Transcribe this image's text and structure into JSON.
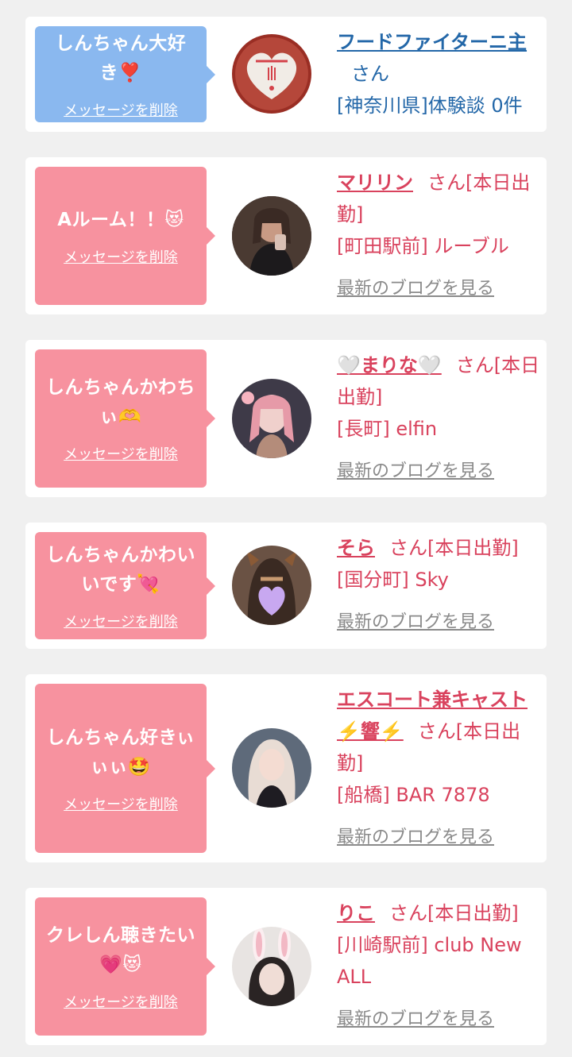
{
  "delete_label": "メッセージを削除",
  "blog_label": "最新のブログを見る",
  "colors": {
    "page_bg": "#f0f0f0",
    "bubble_blue": "#8ab8ef",
    "bubble_pink": "#f7929f",
    "name_blue": "#2367a8",
    "name_pink": "#d9425d",
    "blog_gray": "#8a8a8a"
  },
  "entries": [
    {
      "message": "しんちゃん大好き❣️",
      "name": "フードファイターニ主",
      "suffix": "さん",
      "place": "[神奈川県]体験談 0件",
      "blog": ""
    },
    {
      "message": "Aルーム！！😻",
      "name": "マリリン",
      "suffix": "さん[本日出勤]",
      "place": "[町田駅前] ルーブル",
      "blog": "最新のブログを見る"
    },
    {
      "message": "しんちゃんかわちぃ🫶",
      "name": "🤍まりな🤍",
      "suffix": "さん[本日出勤]",
      "place": "[長町] elfin",
      "blog": "最新のブログを見る"
    },
    {
      "message": "しんちゃんかわいいです💘",
      "name": "そら",
      "suffix": "さん[本日出勤]",
      "place": "[国分町] Sky",
      "blog": "最新のブログを見る"
    },
    {
      "message": "しんちゃん好きぃぃぃ🤩",
      "name": "エスコート兼キャスト⚡️響⚡️",
      "suffix": "さん[本日出勤]",
      "place": "[船橋] BAR 7878",
      "blog": "最新のブログを見る"
    },
    {
      "message": "クレしん聴きたい💗😻",
      "name": "りこ",
      "suffix": "さん[本日出勤]",
      "place": "[川崎駅前] club New ALL",
      "blog": "最新のブログを見る"
    }
  ]
}
